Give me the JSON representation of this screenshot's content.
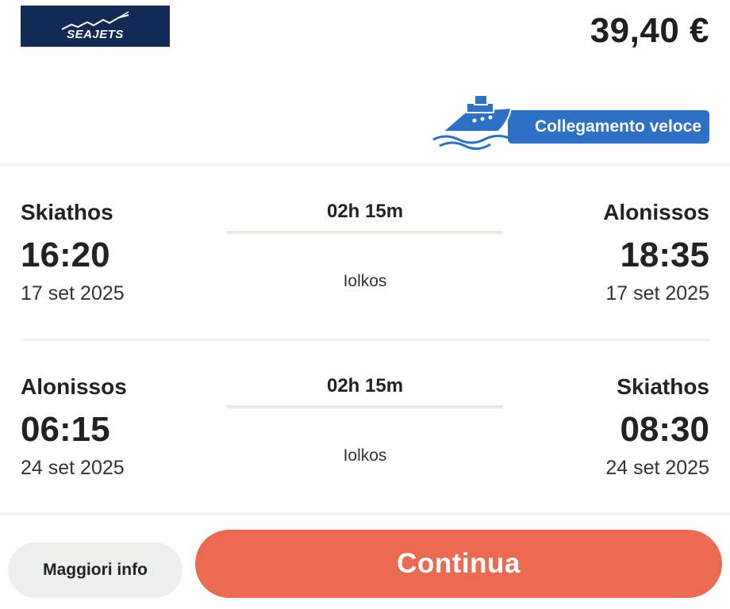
{
  "header": {
    "operator_logo_text": "SEAJETS",
    "price": "39,40 €",
    "badge_label": "Collegamento veloce",
    "badge_color": "#2e70c4"
  },
  "legs": [
    {
      "departure_port": "Skiathos",
      "departure_time": "16:20",
      "departure_date": "17 set 2025",
      "duration": "02h 15m",
      "vessel": "Iolkos",
      "arrival_port": "Alonissos",
      "arrival_time": "18:35",
      "arrival_date": "17 set 2025"
    },
    {
      "departure_port": "Alonissos",
      "departure_time": "06:15",
      "departure_date": "24 set 2025",
      "duration": "02h 15m",
      "vessel": "Iolkos",
      "arrival_port": "Skiathos",
      "arrival_time": "08:30",
      "arrival_date": "24 set 2025"
    }
  ],
  "footer": {
    "more_info_label": "Maggiori info",
    "continue_label": "Continua",
    "continue_color": "#ea6b52"
  }
}
